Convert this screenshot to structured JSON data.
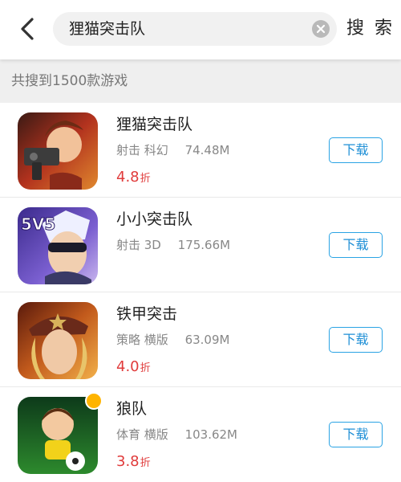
{
  "header": {
    "search_value": "狸猫突击队",
    "search_button_label": "搜 索"
  },
  "results": {
    "summary": "共搜到1500款游戏"
  },
  "games": [
    {
      "title": "狸猫突击队",
      "tags": "射击 科幻",
      "size": "74.48M",
      "discount": "4.8",
      "discount_unit": "折",
      "download_label": "下载"
    },
    {
      "title": "小小突击队",
      "tags": "射击 3D",
      "size": "175.66M",
      "discount": "",
      "discount_unit": "",
      "download_label": "下载",
      "icon_text": "5V5"
    },
    {
      "title": "铁甲突击",
      "tags": "策略 横版",
      "size": "63.09M",
      "discount": "4.0",
      "discount_unit": "折",
      "download_label": "下载"
    },
    {
      "title": "狼队",
      "tags": "体育 横版",
      "size": "103.62M",
      "discount": "3.8",
      "discount_unit": "折",
      "download_label": "下载"
    }
  ],
  "colors": {
    "accent": "#1e8fd6",
    "discount": "#e03b3b",
    "badge": "#ffb400"
  }
}
